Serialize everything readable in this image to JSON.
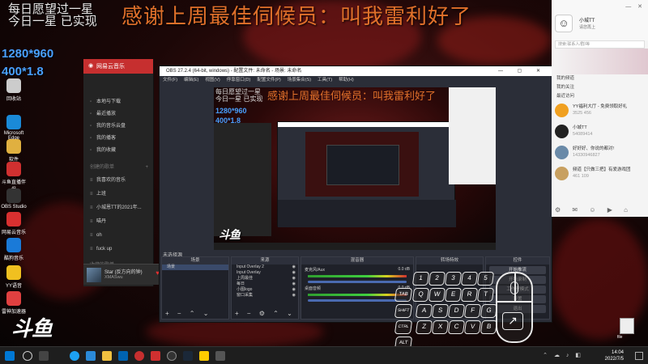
{
  "overlay": {
    "line1": "每日愿望过一星",
    "line2": "今日一星 已实现",
    "banner": "感谢上周最佳伺候员：叫我雷利好了",
    "res1": "1280*960",
    "res2": "400*1.8",
    "logo": "斗鱼"
  },
  "desktop_icons": [
    {
      "label": "回收站"
    },
    {
      "label": "Microsoft Edge"
    },
    {
      "label": "软件"
    },
    {
      "label": "斗鱼直播伴侣"
    },
    {
      "label": "OBS Studio"
    },
    {
      "label": "网易云音乐"
    },
    {
      "label": "酷狗音乐"
    },
    {
      "label": "YY语音"
    },
    {
      "label": "雷神加速器"
    }
  ],
  "netease": {
    "title": "网易云音乐",
    "items": [
      "本地与下载",
      "最近播放",
      "我的音乐云盘",
      "我的播客",
      "我的收藏"
    ],
    "section": "创建的歌单",
    "playlists": [
      "我喜欢的音乐",
      "上班",
      "小城恩TT的2021年...",
      "喵丹",
      "oh",
      "fuck up"
    ],
    "section2": "收藏的歌单",
    "now_playing": {
      "title": "Star (反方向的钟)",
      "artist": "XMASwu"
    }
  },
  "obs": {
    "title": "OBS 27.2.4 (64-bit, windows) - 配置文件: 未命名 - 场景: 未命名",
    "menu": [
      "文件(F)",
      "编辑(E)",
      "视图(V)",
      "停靠窗口(D)",
      "配置文件(P)",
      "场景集合(S)",
      "工具(T)",
      "帮助(H)"
    ],
    "status": "未选择源",
    "panels": {
      "scenes": "场景",
      "sources": "来源",
      "mixer": "混音器",
      "transitions": "转场特效",
      "controls": "控件"
    },
    "scene_item": "场景",
    "sources": [
      "Input Overlay 2",
      "Input Overlay",
      "上周最佳",
      "每日",
      "小图logo",
      "窗口采集"
    ],
    "mixer": [
      {
        "name": "麦克风/Aux",
        "db": "0.0 dB"
      },
      {
        "name": "桌面音频",
        "db": "0.0 dB"
      }
    ],
    "controls": [
      "开始推流",
      "开始录制",
      "工作室模式",
      "设置",
      "退出"
    ]
  },
  "keyboard": {
    "row1": [
      "1",
      "2",
      "3",
      "4",
      "5"
    ],
    "row2_label": "TAB",
    "row2": [
      "Q",
      "W",
      "E",
      "R",
      "T"
    ],
    "row3_label": "SHIFT",
    "row3": [
      "A",
      "S",
      "D",
      "F",
      "G"
    ],
    "row4_label": "CTRL",
    "row4": [
      "Z",
      "X",
      "C",
      "V",
      "B"
    ],
    "alt": "ALT",
    "space": "SPACE"
  },
  "qq": {
    "user": "小城TT",
    "status": "请您再上",
    "search_placeholder": "搜索:联系人/群/等",
    "menu": [
      "我的频道",
      "我的关注",
      "最近访问"
    ],
    "rows": [
      {
        "name": "YY福利大厅 - 免费领取好礼",
        "id": "3525 456"
      },
      {
        "name": "小城TT",
        "id": "54089414"
      },
      {
        "name": "好好好、你说的都对!",
        "id": "14330946827"
      },
      {
        "name": "频道【只做三把】有爱游戏团",
        "id": "461 109"
      }
    ]
  },
  "taskbar": {
    "time": "14:04",
    "date": "2022/7/5"
  },
  "file_icon_label": "file"
}
